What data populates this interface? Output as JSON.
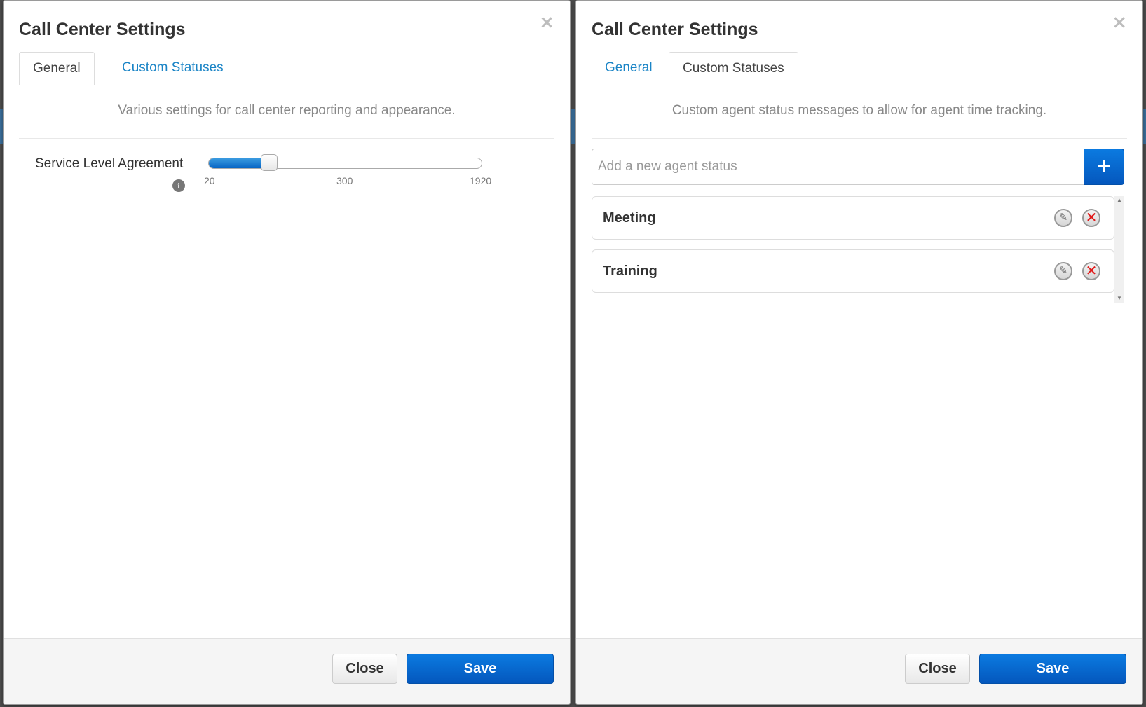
{
  "left_dialog": {
    "title": "Call Center Settings",
    "close_symbol": "×",
    "tabs": [
      {
        "label": "General",
        "active": true
      },
      {
        "label": "Custom Statuses",
        "active": false
      }
    ],
    "description": "Various settings for call center reporting and appearance.",
    "sla": {
      "label": "Service Level Agreement",
      "info_icon": "i",
      "min": 20,
      "max": 1920,
      "current_fraction": 0.22,
      "ticks": [
        "20",
        "300",
        "1920"
      ]
    },
    "footer": {
      "close_label": "Close",
      "save_label": "Save"
    }
  },
  "right_dialog": {
    "title": "Call Center Settings",
    "close_symbol": "×",
    "tabs": [
      {
        "label": "General",
        "active": false
      },
      {
        "label": "Custom Statuses",
        "active": true
      }
    ],
    "description": "Custom agent status messages to allow for agent time tracking.",
    "add_status": {
      "placeholder": "Add a new agent status",
      "button_label": "+"
    },
    "statuses": [
      {
        "name": "Meeting",
        "edit_icon": "✎",
        "delete_icon": "✕"
      },
      {
        "name": "Training",
        "edit_icon": "✎",
        "delete_icon": "✕"
      }
    ],
    "footer": {
      "close_label": "Close",
      "save_label": "Save"
    }
  },
  "colors": {
    "accent": "#0765c4",
    "link": "#1a84c6",
    "delete": "#e01818"
  }
}
